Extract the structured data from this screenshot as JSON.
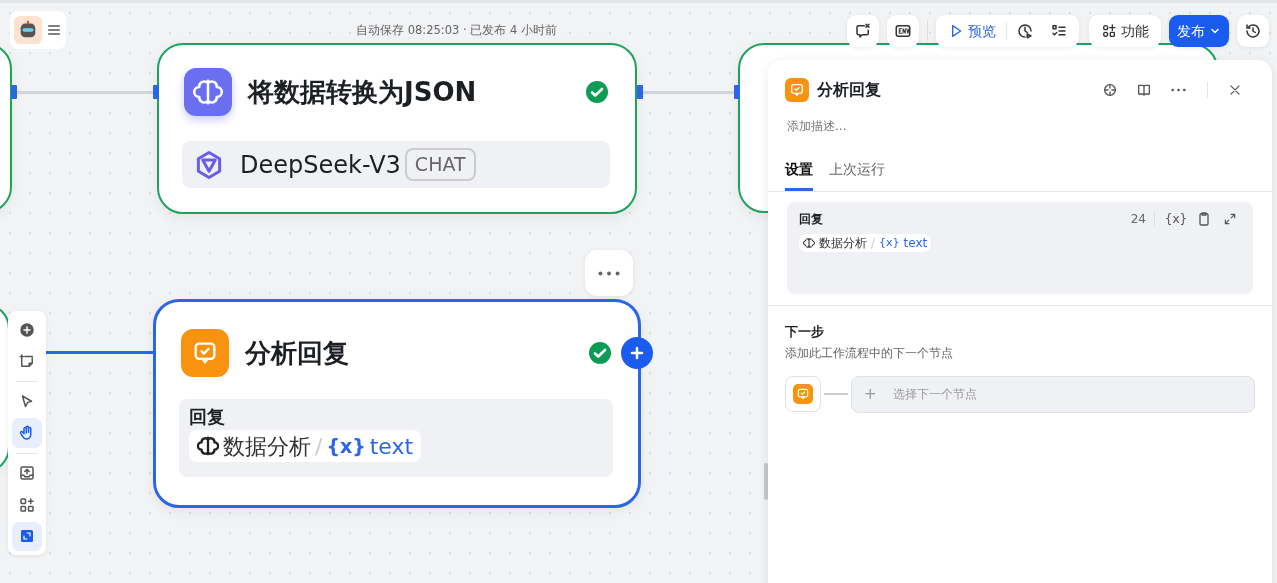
{
  "header": {
    "autosave_status": "自动保存 08:25:03 · 已发布 4 小时前"
  },
  "toolbar": {
    "preview": "预览",
    "features": "功能",
    "publish": "发布"
  },
  "nodes": [
    {
      "kind": "llm",
      "title": "将数据转换为JSON",
      "succeeded": true,
      "selected": false,
      "model": "DeepSeek-V3",
      "model_tag": "CHAT"
    },
    {
      "kind": "reply",
      "title": "分析回复",
      "succeeded": true,
      "selected": true,
      "label": "回复",
      "source": "数据分析",
      "separator": "/",
      "variable_marker": "{x}",
      "variable": "text"
    }
  ],
  "canvas_tools": [
    {
      "kind": "add",
      "selected": false
    },
    {
      "kind": "note",
      "selected": false
    },
    {
      "kind": "pointer",
      "selected": false
    },
    {
      "kind": "hand",
      "selected": true
    },
    {
      "kind": "import",
      "selected": false
    },
    {
      "kind": "apps",
      "selected": false
    },
    {
      "kind": "minimap",
      "selected": true
    }
  ],
  "panel": {
    "title": "分析回复",
    "description_placeholder": "添加描述...",
    "tabs": [
      {
        "label": "设置",
        "selected": true
      },
      {
        "label": "上次运行",
        "selected": false
      }
    ],
    "reply": {
      "label": "回复",
      "count": "24",
      "insert_variable": "{x}",
      "source": "数据分析",
      "separator": "/",
      "variable_marker": "{x}",
      "variable": "text"
    },
    "next_step": {
      "title": "下一步",
      "description": "添加此工作流程中的下一个节点",
      "plus": "+",
      "placeholder": "选择下一个节点"
    }
  }
}
